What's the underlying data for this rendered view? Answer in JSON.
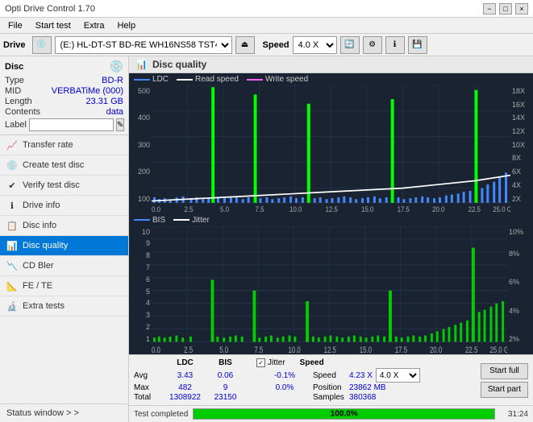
{
  "titlebar": {
    "title": "Opti Drive Control 1.70",
    "minimize": "−",
    "maximize": "□",
    "close": "×"
  },
  "menu": {
    "items": [
      "File",
      "Start test",
      "Extra",
      "Help"
    ]
  },
  "toolbar": {
    "drive_label": "Drive",
    "drive_value": "(E:)  HL-DT-ST BD-RE  WH16NS58 TST4",
    "speed_label": "Speed",
    "speed_value": "4.0 X"
  },
  "disc": {
    "section_label": "Disc",
    "type_label": "Type",
    "type_value": "BD-R",
    "mid_label": "MID",
    "mid_value": "VERBATiMe (000)",
    "length_label": "Length",
    "length_value": "23.31 GB",
    "contents_label": "Contents",
    "contents_value": "data",
    "label_label": "Label",
    "label_placeholder": ""
  },
  "nav": {
    "items": [
      {
        "id": "transfer-rate",
        "label": "Transfer rate",
        "icon": "📈"
      },
      {
        "id": "create-test-disc",
        "label": "Create test disc",
        "icon": "💿"
      },
      {
        "id": "verify-test-disc",
        "label": "Verify test disc",
        "icon": "✔"
      },
      {
        "id": "drive-info",
        "label": "Drive info",
        "icon": "ℹ"
      },
      {
        "id": "disc-info",
        "label": "Disc info",
        "icon": "📋"
      },
      {
        "id": "disc-quality",
        "label": "Disc quality",
        "icon": "📊",
        "active": true
      },
      {
        "id": "cd-bler",
        "label": "CD Bler",
        "icon": "📉"
      },
      {
        "id": "fe-te",
        "label": "FE / TE",
        "icon": "📐"
      },
      {
        "id": "extra-tests",
        "label": "Extra tests",
        "icon": "🔬"
      }
    ],
    "status_window": "Status window > >"
  },
  "chart": {
    "title": "Disc quality",
    "legend": {
      "ldc_label": "LDC",
      "read_label": "Read speed",
      "write_label": "Write speed",
      "bis_label": "BIS",
      "jitter_label": "Jitter"
    },
    "top_y_max": "500",
    "top_y_labels": [
      "500",
      "400",
      "300",
      "200",
      "100"
    ],
    "top_y2_labels": [
      "18X",
      "16X",
      "14X",
      "12X",
      "10X",
      "8X",
      "6X",
      "4X",
      "2X"
    ],
    "x_labels": [
      "0.0",
      "2.5",
      "5.0",
      "7.5",
      "10.0",
      "12.5",
      "15.0",
      "17.5",
      "20.0",
      "22.5",
      "25.0 GB"
    ],
    "bot_y_labels": [
      "10",
      "9",
      "8",
      "7",
      "6",
      "5",
      "4",
      "3",
      "2",
      "1"
    ],
    "bot_y2_labels": [
      "10%",
      "8%",
      "6%",
      "4%",
      "2%"
    ]
  },
  "stats": {
    "col_headers": [
      "",
      "LDC",
      "BIS",
      "",
      "Jitter",
      "Speed",
      ""
    ],
    "avg_label": "Avg",
    "avg_ldc": "3.43",
    "avg_bis": "0.06",
    "avg_jitter": "-0.1%",
    "max_label": "Max",
    "max_ldc": "482",
    "max_bis": "9",
    "max_jitter": "0.0%",
    "total_label": "Total",
    "total_ldc": "1308922",
    "total_bis": "23150",
    "speed_label": "Speed",
    "speed_value": "4.23 X",
    "speed_select": "4.0 X",
    "position_label": "Position",
    "position_value": "23862 MB",
    "samples_label": "Samples",
    "samples_value": "380368",
    "start_full": "Start full",
    "start_part": "Start part"
  },
  "statusbar": {
    "status_text": "Test completed",
    "progress_pct": "100.0%",
    "progress_width": 100,
    "time": "31:24"
  }
}
